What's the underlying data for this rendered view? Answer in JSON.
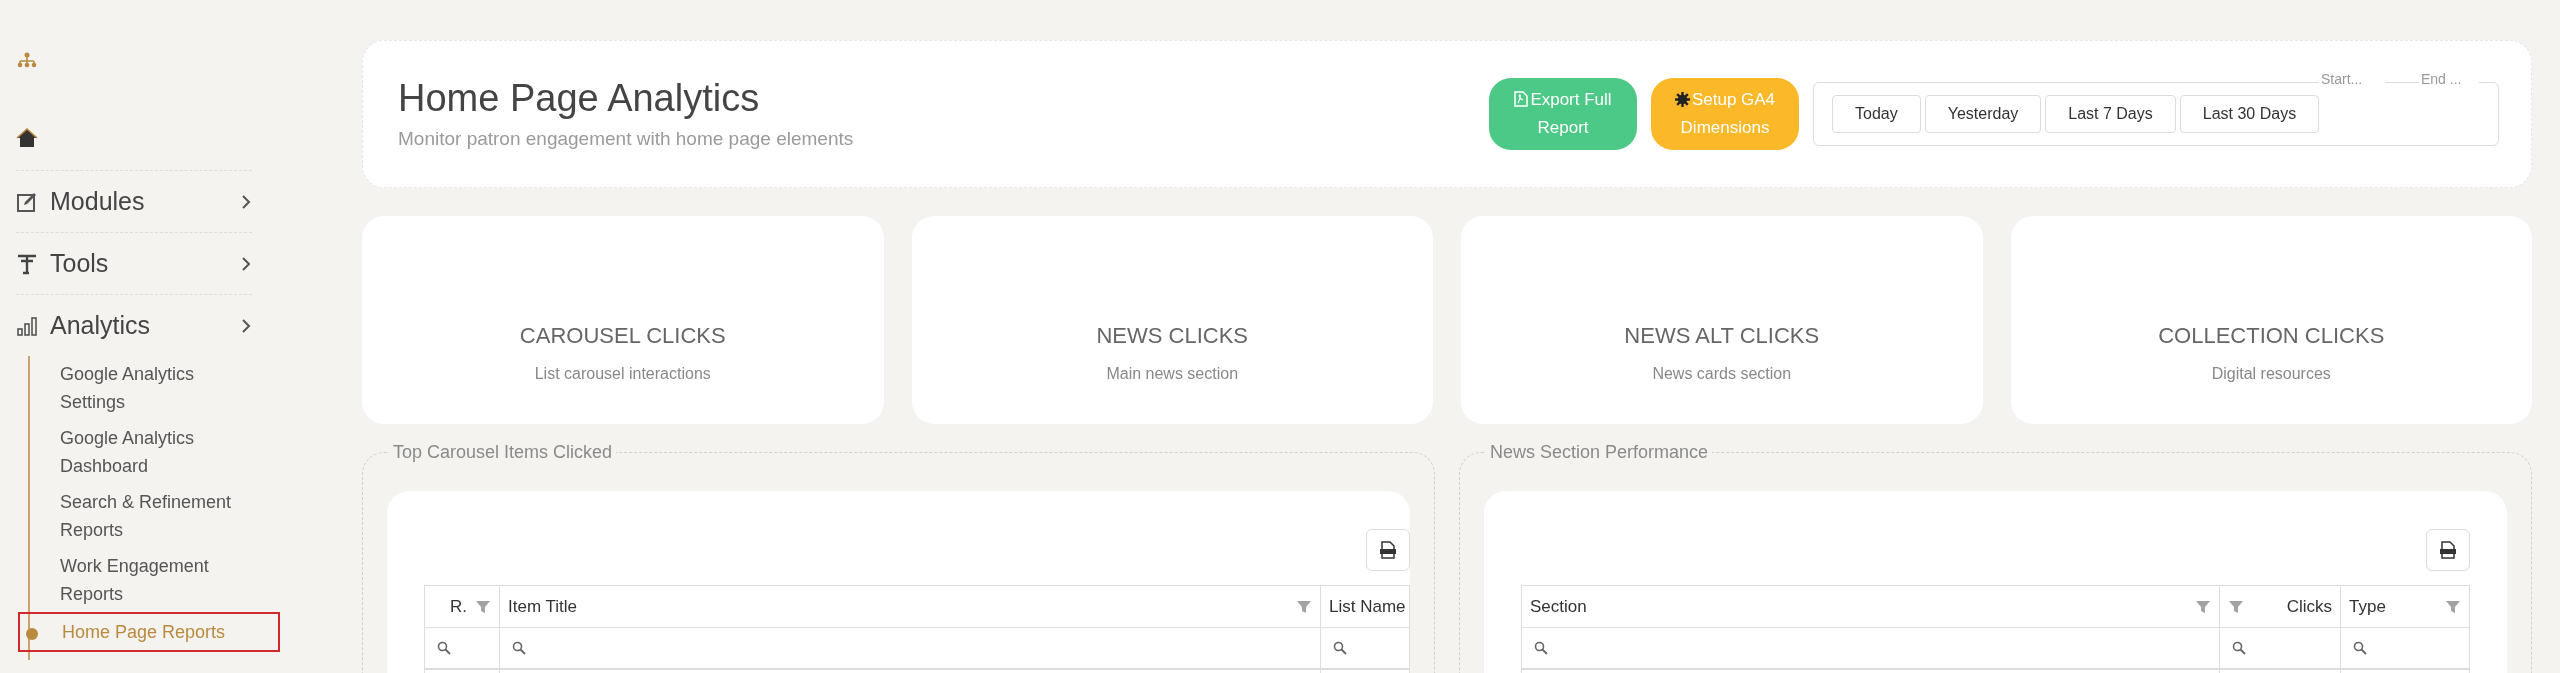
{
  "sidebar": {
    "items": [
      {
        "label": "Modules"
      },
      {
        "label": "Tools"
      },
      {
        "label": "Analytics",
        "children": [
          {
            "label": "Google Analytics Settings",
            "selected": false
          },
          {
            "label": "Google Analytics Dashboard",
            "selected": false
          },
          {
            "label": "Search & Refinement Reports",
            "selected": false
          },
          {
            "label": "Work Engagement Reports",
            "selected": false
          },
          {
            "label": "Home Page Reports",
            "selected": true
          }
        ]
      }
    ]
  },
  "header": {
    "title": "Home Page Analytics",
    "subtitle": "Monitor patron engagement with home page elements",
    "buttons": [
      {
        "label": "Export Full Report",
        "kind": "export"
      },
      {
        "label": "Setup GA4 Dimensions",
        "kind": "setup"
      }
    ],
    "date_presets": [
      "Today",
      "Yesterday",
      "Last 7 Days",
      "Last 30 Days"
    ],
    "start": {
      "placeholder": "Start..."
    },
    "end": {
      "placeholder": "End ..."
    }
  },
  "stats": [
    {
      "title": "CAROUSEL CLICKS",
      "subtitle": "List carousel interactions"
    },
    {
      "title": "NEWS CLICKS",
      "subtitle": "Main news section"
    },
    {
      "title": "NEWS ALT CLICKS",
      "subtitle": "News cards section"
    },
    {
      "title": "COLLECTION CLICKS",
      "subtitle": "Digital resources"
    }
  ],
  "panels": [
    {
      "title": "Top Carousel Items Clicked",
      "columns": [
        "R.",
        "Item Title",
        "List Name"
      ]
    },
    {
      "title": "News Section Performance",
      "columns": [
        "Section",
        "Clicks",
        "Type"
      ]
    }
  ]
}
